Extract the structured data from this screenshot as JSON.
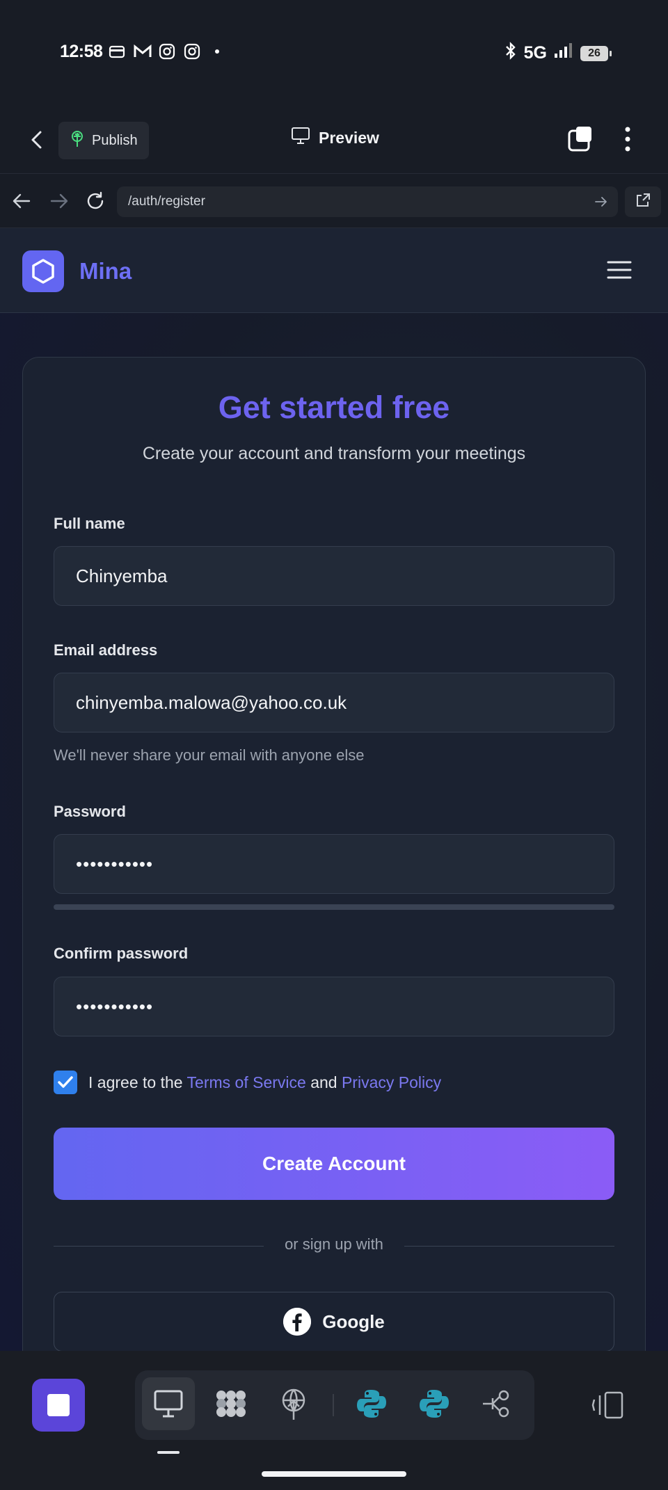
{
  "status_bar": {
    "time": "12:58",
    "network": "5G",
    "battery": "26"
  },
  "app_bar": {
    "publish_label": "Publish",
    "preview_label": "Preview"
  },
  "url_bar": {
    "path": "/auth/register"
  },
  "site": {
    "brand": "Mina"
  },
  "form": {
    "title": "Get started free",
    "subtitle": "Create your account and transform your meetings",
    "full_name_label": "Full name",
    "full_name_value": "Chinyemba",
    "email_label": "Email address",
    "email_value": "chinyemba.malowa@yahoo.co.uk",
    "email_hint": "We'll never share your email with anyone else",
    "password_label": "Password",
    "password_value": "•••••••••••",
    "confirm_label": "Confirm password",
    "confirm_value": "•••••••••••",
    "agree_prefix": "I agree to the",
    "terms_link": "Terms of Service",
    "agree_and": "and",
    "privacy_link": "Privacy Policy",
    "terms_checked": true,
    "submit_label": "Create Account",
    "divider_text": "or sign up with",
    "social_label": "Google"
  },
  "colors": {
    "accent": "#6366f1",
    "accent_end": "#8b5cf6",
    "checkbox": "#2f80ed",
    "link": "#7b79f0"
  }
}
